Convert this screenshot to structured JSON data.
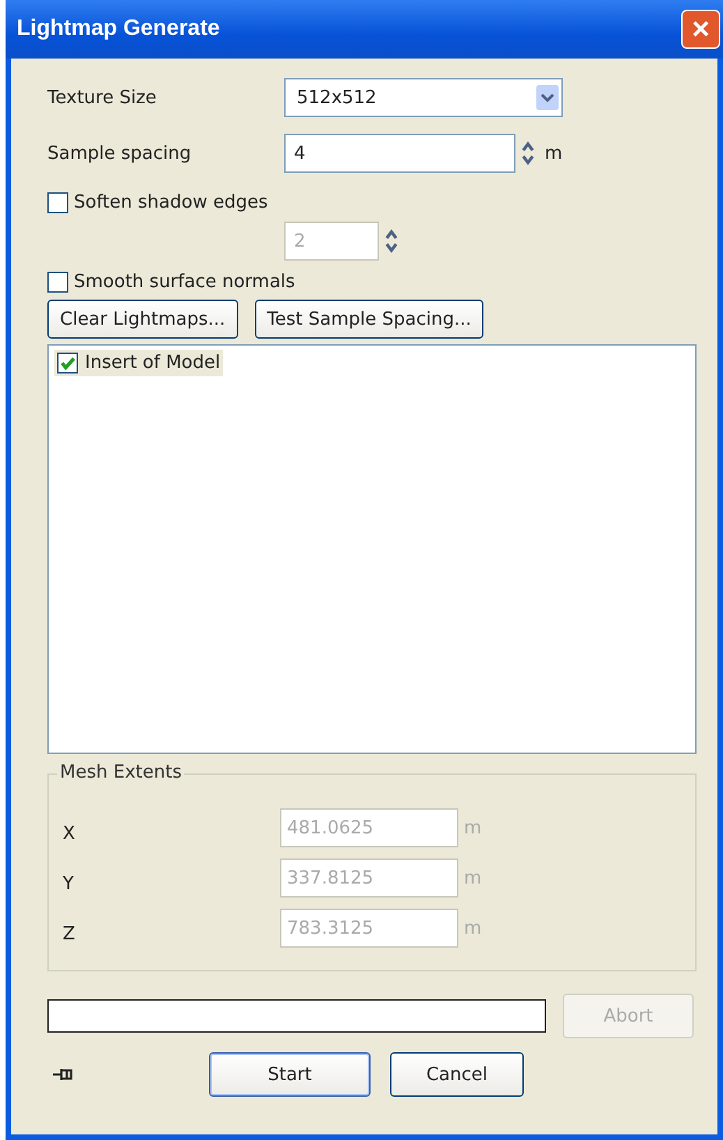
{
  "window": {
    "title": "Lightmap Generate",
    "close": "×"
  },
  "texture_size": {
    "label": "Texture Size",
    "value": "512x512"
  },
  "sample_spacing": {
    "label": "Sample spacing",
    "value": "4",
    "unit": "m",
    "disabled": false
  },
  "soften": {
    "label": "Soften shadow edges",
    "checked": false
  },
  "soften_amount": {
    "value": "2",
    "disabled": true
  },
  "smooth": {
    "label": "Smooth surface normals",
    "checked": false
  },
  "buttons": [
    "Clear Lightmaps...",
    "Test Sample Spacing..."
  ],
  "list": [
    {
      "label": "Insert of Model",
      "checked": true,
      "selected": true
    }
  ],
  "mesh_extents": {
    "title": "Mesh Extents",
    "rows": [
      {
        "axis": "X",
        "value": "481.0625",
        "unit": "m",
        "disabled": true
      },
      {
        "axis": "Y",
        "value": "337.8125",
        "unit": "m",
        "disabled": true
      },
      {
        "axis": "Z",
        "value": "783.3125",
        "unit": "m",
        "disabled": true
      }
    ]
  },
  "abort": {
    "label": "Abort",
    "disabled": true
  },
  "footer": [
    "Start",
    "Cancel"
  ]
}
